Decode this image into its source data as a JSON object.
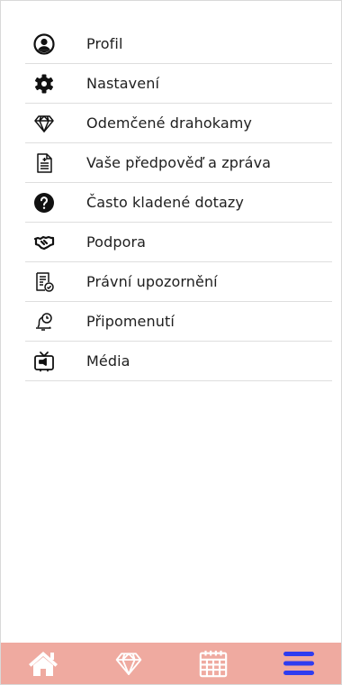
{
  "menu": {
    "items": [
      {
        "label": "Profil",
        "icon": "profile-icon"
      },
      {
        "label": "Nastavení",
        "icon": "gear-icon"
      },
      {
        "label": "Odemčené drahokamy",
        "icon": "diamond-icon"
      },
      {
        "label": "Vaše předpověď a zpráva",
        "icon": "document-icon"
      },
      {
        "label": "Často kladené dotazy",
        "icon": "question-icon"
      },
      {
        "label": "Podpora",
        "icon": "handshake-icon"
      },
      {
        "label": "Právní upozornění",
        "icon": "legal-notice-icon"
      },
      {
        "label": "Připomenutí",
        "icon": "bell-clock-icon"
      },
      {
        "label": "Média",
        "icon": "tv-icon"
      }
    ]
  },
  "bottom_nav": {
    "items": [
      {
        "name": "home",
        "icon": "home-icon"
      },
      {
        "name": "gems",
        "icon": "diamond-icon"
      },
      {
        "name": "calendar",
        "icon": "calendar-icon"
      },
      {
        "name": "menu",
        "icon": "hamburger-menu-icon",
        "active": true
      }
    ],
    "background": "#efaaa0",
    "icon_color": "#ffffff",
    "active_color": "#2f3cf0"
  }
}
